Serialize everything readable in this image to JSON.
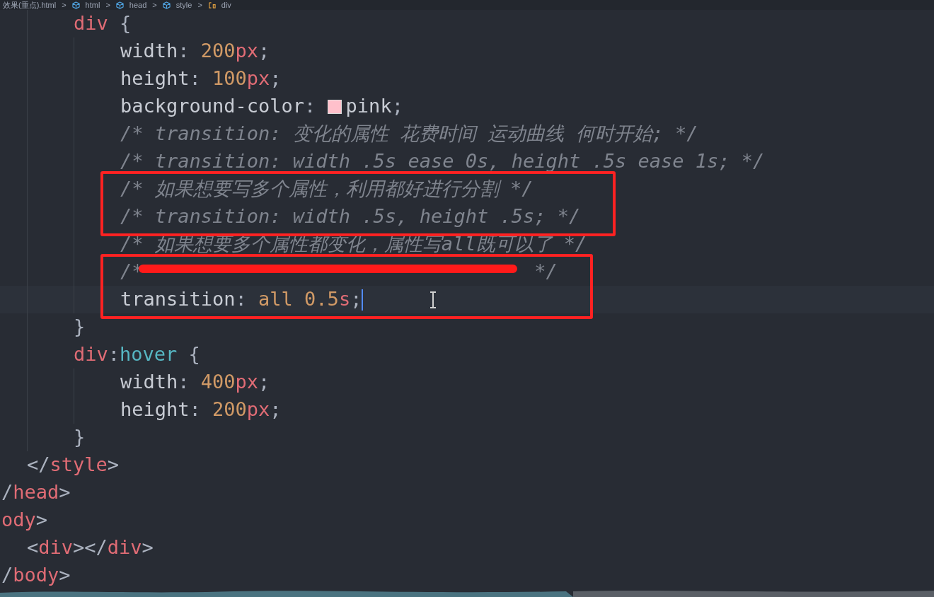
{
  "breadcrumb": {
    "separator": ">",
    "items": [
      {
        "label": "效果(重点).html",
        "kind": "file"
      },
      {
        "label": "html",
        "kind": "element"
      },
      {
        "label": "head",
        "kind": "element"
      },
      {
        "label": "style",
        "kind": "element"
      },
      {
        "label": "div",
        "kind": "rule"
      }
    ]
  },
  "lines": [
    {
      "children": [
        {
          "children": [
            {
              "tokens": [
                {
                  "text": "div",
                  "kind": "selector"
                },
                {
                  "text": " {",
                  "kind": "punct"
                }
              ]
            },
            {
              "children": [
                {
                  "tokens": [
                    {
                      "text": "width",
                      "kind": "prop"
                    },
                    {
                      "text": ": ",
                      "kind": "punct"
                    },
                    {
                      "text": "200",
                      "kind": "number"
                    },
                    {
                      "text": "px",
                      "kind": "unit"
                    },
                    {
                      "text": ";",
                      "kind": "punct"
                    }
                  ]
                },
                {
                  "tokens": [
                    {
                      "text": "height",
                      "kind": "prop"
                    },
                    {
                      "text": ": ",
                      "kind": "punct"
                    },
                    {
                      "text": "100",
                      "kind": "number"
                    },
                    {
                      "text": "px",
                      "kind": "unit"
                    },
                    {
                      "text": ";",
                      "kind": "punct"
                    }
                  ]
                },
                {
                  "tokens": [
                    {
                      "text": "background-color",
                      "kind": "prop"
                    },
                    {
                      "text": ": ",
                      "kind": "punct"
                    },
                    {
                      "kind": "swatch",
                      "color": "#ffc0cb"
                    },
                    {
                      "text": "pink",
                      "kind": "value"
                    },
                    {
                      "text": ";",
                      "kind": "punct"
                    }
                  ]
                },
                {
                  "tokens": [
                    {
                      "text": "/* transition: 变化的属性 花费时间 运动曲线 何时开始; */",
                      "kind": "comment"
                    }
                  ]
                },
                {
                  "tokens": [
                    {
                      "text": "/* transition: width .5s ease 0s, height .5s ease 1s; */",
                      "kind": "comment"
                    }
                  ]
                },
                {
                  "boxed": true,
                  "tokens": [
                    {
                      "text": "/* 如果想要写多个属性，利用都好进行分割 */",
                      "kind": "comment"
                    }
                  ]
                },
                {
                  "boxed": true,
                  "tokens": [
                    {
                      "text": "/* transition: width .5s, height .5s; */",
                      "kind": "comment"
                    }
                  ]
                },
                {
                  "tokens": [
                    {
                      "text": "/* 如果想要多个属性都变化，属性写all既可以了 */",
                      "kind": "comment"
                    }
                  ]
                },
                {
                  "boxed": true,
                  "struck": true,
                  "tokens": [
                    {
                      "text": "/*",
                      "kind": "comment"
                    },
                    {
                      "text": "*/",
                      "kind": "comment"
                    }
                  ]
                },
                {
                  "boxed": true,
                  "cursor": true,
                  "tokens": [
                    {
                      "text": "transition",
                      "kind": "prop"
                    },
                    {
                      "text": ": ",
                      "kind": "punct"
                    },
                    {
                      "text": "all 0.5",
                      "kind": "number"
                    },
                    {
                      "text": "s",
                      "kind": "unit"
                    },
                    {
                      "text": ";",
                      "kind": "punct"
                    }
                  ]
                }
              ]
            },
            {
              "tokens": [
                {
                  "text": "}",
                  "kind": "punct"
                }
              ]
            },
            {
              "tokens": [
                {
                  "text": "div",
                  "kind": "selector"
                },
                {
                  "text": ":",
                  "kind": "punct"
                },
                {
                  "text": "hover",
                  "kind": "pseudo"
                },
                {
                  "text": " {",
                  "kind": "punct"
                }
              ]
            },
            {
              "children": [
                {
                  "tokens": [
                    {
                      "text": "width",
                      "kind": "prop"
                    },
                    {
                      "text": ": ",
                      "kind": "punct"
                    },
                    {
                      "text": "400",
                      "kind": "number"
                    },
                    {
                      "text": "px",
                      "kind": "unit"
                    },
                    {
                      "text": ";",
                      "kind": "punct"
                    }
                  ]
                },
                {
                  "tokens": [
                    {
                      "text": "height",
                      "kind": "prop"
                    },
                    {
                      "text": ": ",
                      "kind": "punct"
                    },
                    {
                      "text": "200",
                      "kind": "number"
                    },
                    {
                      "text": "px",
                      "kind": "unit"
                    },
                    {
                      "text": ";",
                      "kind": "punct"
                    }
                  ]
                }
              ]
            },
            {
              "tokens": [
                {
                  "text": "}",
                  "kind": "punct"
                }
              ]
            }
          ]
        },
        {
          "tokens": [
            {
              "text": "</",
              "kind": "punct"
            },
            {
              "text": "style",
              "kind": "tag"
            },
            {
              "text": ">",
              "kind": "punct"
            }
          ]
        }
      ]
    },
    {
      "tokens": [
        {
          "text": "/",
          "kind": "punct"
        },
        {
          "text": "head",
          "kind": "tag"
        },
        {
          "text": ">",
          "kind": "punct"
        }
      ]
    },
    {
      "tokens": [
        {
          "text": "ody",
          "kind": "tag"
        },
        {
          "text": ">",
          "kind": "punct"
        }
      ]
    },
    {
      "children": [
        {
          "tokens": [
            {
              "text": "<",
              "kind": "punct"
            },
            {
              "text": "div",
              "kind": "tag"
            },
            {
              "text": "></",
              "kind": "punct"
            },
            {
              "text": "div",
              "kind": "tag"
            },
            {
              "text": ">",
              "kind": "punct"
            }
          ]
        }
      ]
    },
    {
      "tokens": [
        {
          "text": "/",
          "kind": "punct"
        },
        {
          "text": "body",
          "kind": "tag"
        },
        {
          "text": ">",
          "kind": "punct"
        }
      ]
    }
  ]
}
